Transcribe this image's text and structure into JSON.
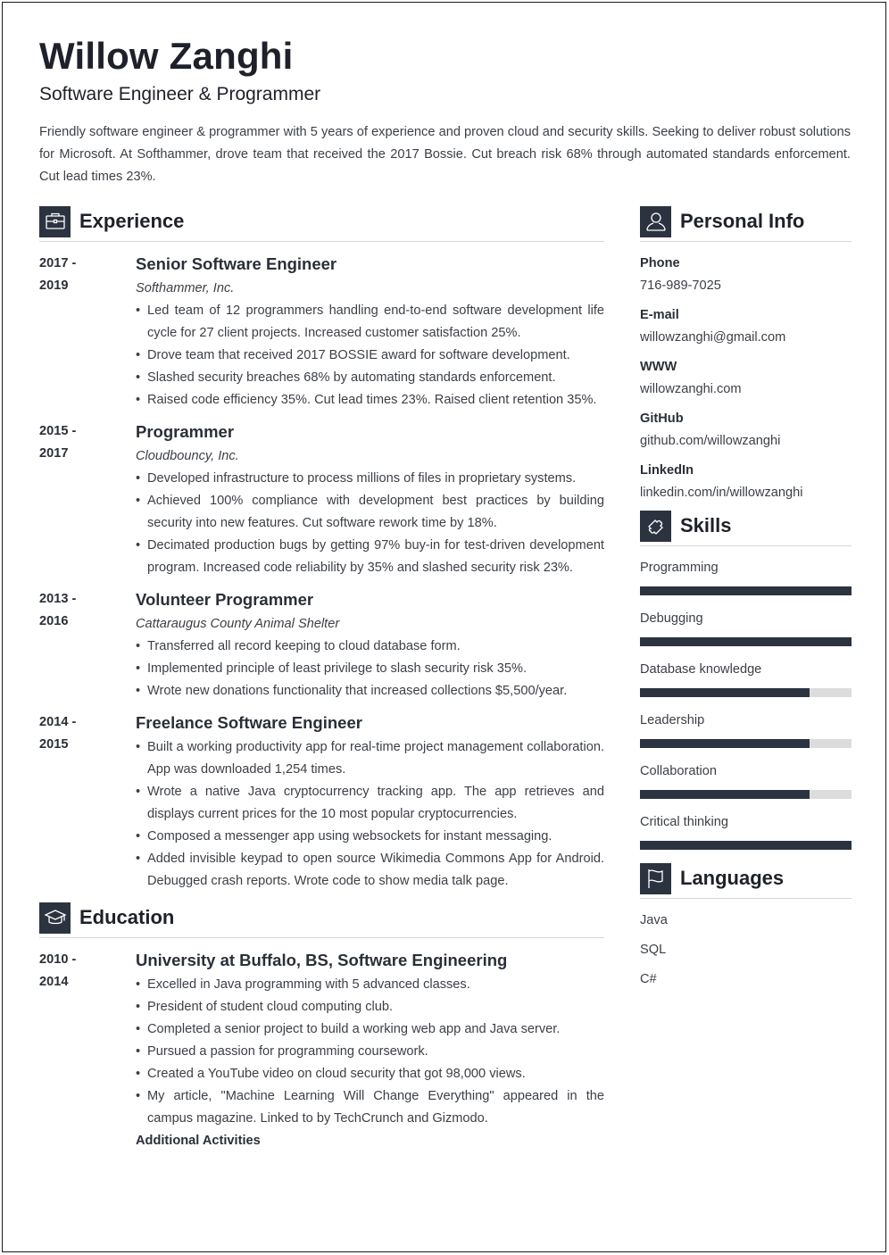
{
  "header": {
    "name": "Willow Zanghi",
    "title": "Software Engineer & Programmer",
    "summary": "Friendly software engineer & programmer with 5 years of experience and proven cloud and security skills. Seeking to deliver robust solutions for Microsoft. At Softhammer, drove team that received the 2017 Bossie. Cut breach risk 68% through automated standards enforcement. Cut lead times 23%."
  },
  "experience": {
    "heading": "Experience",
    "icon": "briefcase-icon",
    "entries": [
      {
        "date_start": "2017 -",
        "date_end": "2019",
        "role": "Senior Software Engineer",
        "company": "Softhammer, Inc.",
        "bullets": [
          "Led team of 12 programmers handling end-to-end software development life cycle for 27 client projects. Increased customer satisfaction 25%.",
          "Drove team that received 2017 BOSSIE award for software development.",
          "Slashed security breaches 68% by automating standards enforcement.",
          "Raised code efficiency 35%. Cut lead times 23%. Raised client retention 35%."
        ]
      },
      {
        "date_start": "2015 -",
        "date_end": "2017",
        "role": "Programmer",
        "company": "Cloudbouncy, Inc.",
        "bullets": [
          "Developed infrastructure to process millions of files in proprietary systems.",
          "Achieved 100% compliance with development best practices by building security into new features. Cut software rework time by 18%.",
          "Decimated production bugs by getting 97% buy-in for test-driven development program. Increased code reliability by 35% and slashed security risk 23%."
        ]
      },
      {
        "date_start": "2013 -",
        "date_end": "2016",
        "role": "Volunteer Programmer",
        "company": "Cattaraugus County Animal Shelter",
        "bullets": [
          "Transferred all record keeping to cloud database form.",
          "Implemented principle of least privilege to slash security risk 35%.",
          "Wrote new donations functionality that increased collections $5,500/year."
        ]
      },
      {
        "date_start": "2014 -",
        "date_end": "2015",
        "role": "Freelance Software Engineer",
        "company": "",
        "bullets": [
          "Built a working productivity app for real-time project management collaboration. App was downloaded 1,254 times.",
          "Wrote a native Java cryptocurrency tracking app. The app retrieves and displays current prices for the 10 most popular cryptocurrencies.",
          "Composed a messenger app using websockets for instant messaging.",
          "Added invisible keypad to open source Wikimedia Commons App for Android. Debugged crash reports. Wrote code to show media talk page."
        ]
      }
    ]
  },
  "education": {
    "heading": "Education",
    "icon": "graduation-cap-icon",
    "entries": [
      {
        "date_start": "2010 -",
        "date_end": "2014",
        "role": "University at Buffalo, BS, Software Engineering",
        "bullets": [
          "Excelled in Java programming with 5 advanced classes.",
          "President of student cloud computing club.",
          "Completed a senior project to build a working web app and Java server.",
          "Pursued a passion for programming coursework.",
          "Created a YouTube video on cloud security that got 98,000 views.",
          "My article, \"Machine Learning Will Change Everything\" appeared in the campus magazine. Linked to by TechCrunch and Gizmodo."
        ],
        "additional": "Additional Activities"
      }
    ]
  },
  "personal_info": {
    "heading": "Personal Info",
    "icon": "user-icon",
    "items": [
      {
        "label": "Phone",
        "value": "716-989-7025"
      },
      {
        "label": "E-mail",
        "value": "willowzanghi@gmail.com"
      },
      {
        "label": "WWW",
        "value": "willowzanghi.com"
      },
      {
        "label": "GitHub",
        "value": "github.com/willowzanghi"
      },
      {
        "label": "LinkedIn",
        "value": "linkedin.com/in/willowzanghi"
      }
    ]
  },
  "skills": {
    "heading": "Skills",
    "icon": "puzzle-icon",
    "items": [
      {
        "name": "Programming",
        "level": 1.0
      },
      {
        "name": "Debugging",
        "level": 1.0
      },
      {
        "name": "Database knowledge",
        "level": 0.8
      },
      {
        "name": "Leadership",
        "level": 0.8
      },
      {
        "name": "Collaboration",
        "level": 0.8
      },
      {
        "name": "Critical thinking",
        "level": 1.0
      }
    ]
  },
  "languages": {
    "heading": "Languages",
    "icon": "flag-icon",
    "items": [
      "Java",
      "SQL",
      "C#"
    ]
  },
  "colors": {
    "accent": "#2c3340",
    "bar_track": "#dcdcdc",
    "text": "#3b3f46",
    "heading": "#1e212a"
  }
}
